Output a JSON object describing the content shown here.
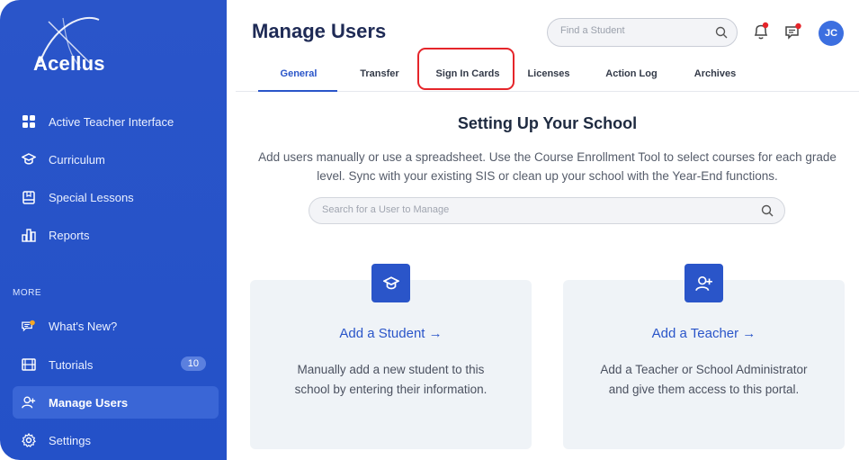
{
  "sidebar": {
    "logo": "Acellus",
    "items": [
      {
        "label": "Active Teacher Interface",
        "icon": "grid-icon"
      },
      {
        "label": "Curriculum",
        "icon": "graduation-cap-icon"
      },
      {
        "label": "Special Lessons",
        "icon": "book-icon"
      },
      {
        "label": "Reports",
        "icon": "bar-chart-icon"
      }
    ],
    "more_label": "MORE",
    "more_items": [
      {
        "label": "What's New?",
        "icon": "chat-notification-icon"
      },
      {
        "label": "Tutorials",
        "icon": "film-icon",
        "badge": "10"
      },
      {
        "label": "Manage Users",
        "icon": "add-user-icon",
        "active": true
      },
      {
        "label": "Settings",
        "icon": "gear-icon"
      }
    ]
  },
  "header": {
    "title": "Manage Users",
    "search_placeholder": "Find a Student",
    "avatar_initials": "JC"
  },
  "tabs": [
    {
      "label": "General",
      "active": true
    },
    {
      "label": "Transfer"
    },
    {
      "label": "Sign In Cards",
      "highlighted": true
    },
    {
      "label": "Licenses"
    },
    {
      "label": "Action Log"
    },
    {
      "label": "Archives"
    }
  ],
  "main": {
    "title": "Setting Up Your School",
    "description": "Add users manually or use a spreadsheet. Use the Course Enrollment Tool to select courses for each grade level. Sync with your existing SIS or clean up your school with the Year-End functions.",
    "search_placeholder": "Search for a User to Manage",
    "cards": [
      {
        "link": "Add a Student →",
        "description": "Manually add a new student to this school by entering their information.",
        "icon": "graduation-cap-icon"
      },
      {
        "link": "Add a Teacher →",
        "description": "Add a Teacher or School Administrator and give them access to this portal.",
        "icon": "add-user-icon"
      }
    ]
  },
  "colors": {
    "sidebar": "#2451c8",
    "accent": "#2a55c9",
    "highlight": "#e5252a",
    "notification": "#e5252a"
  }
}
